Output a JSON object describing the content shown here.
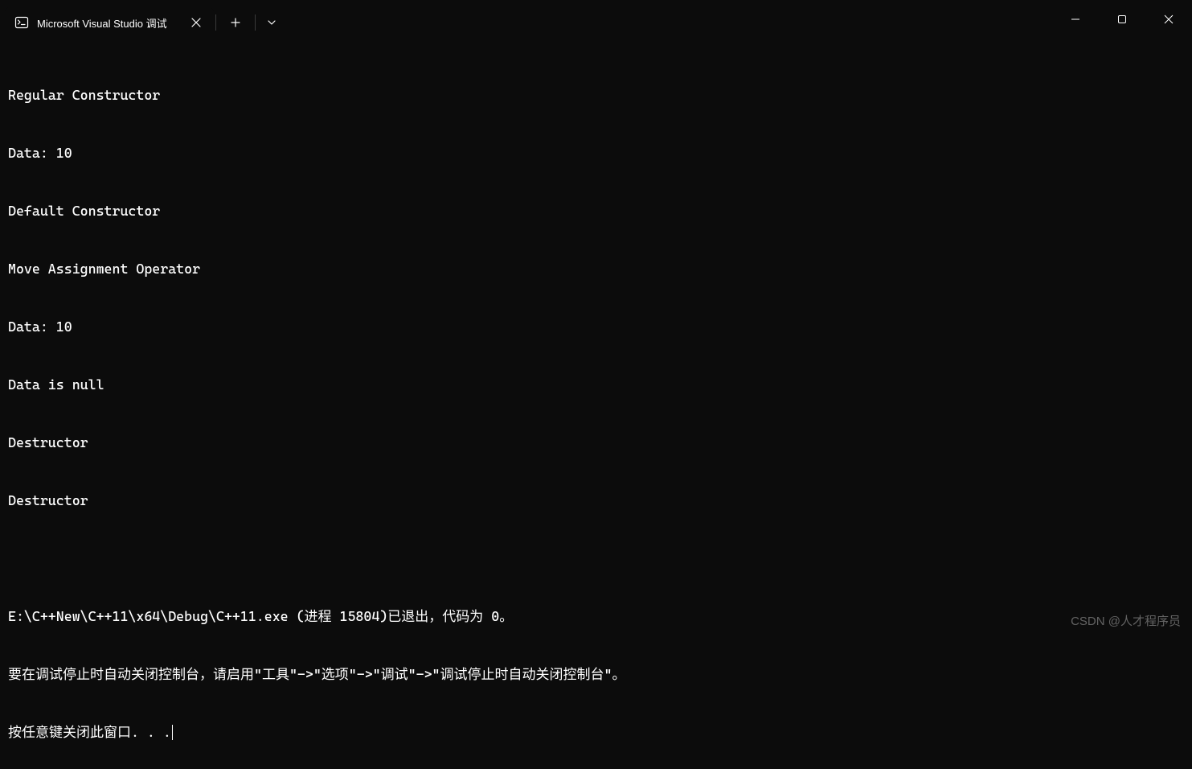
{
  "titleBar": {
    "tab": {
      "title": "Microsoft Visual Studio 调试"
    }
  },
  "console": {
    "lines": [
      "Regular Constructor",
      "Data: 10",
      "Default Constructor",
      "Move Assignment Operator",
      "Data: 10",
      "Data is null",
      "Destructor",
      "Destructor",
      "",
      "E:\\C++New\\C++11\\x64\\Debug\\C++11.exe (进程 15804)已退出，代码为 0。",
      "要在调试停止时自动关闭控制台，请启用\"工具\"->\"选项\"->\"调试\"->\"调试停止时自动关闭控制台\"。",
      "按任意键关闭此窗口. . ."
    ]
  },
  "watermark": "CSDN @人才程序员"
}
